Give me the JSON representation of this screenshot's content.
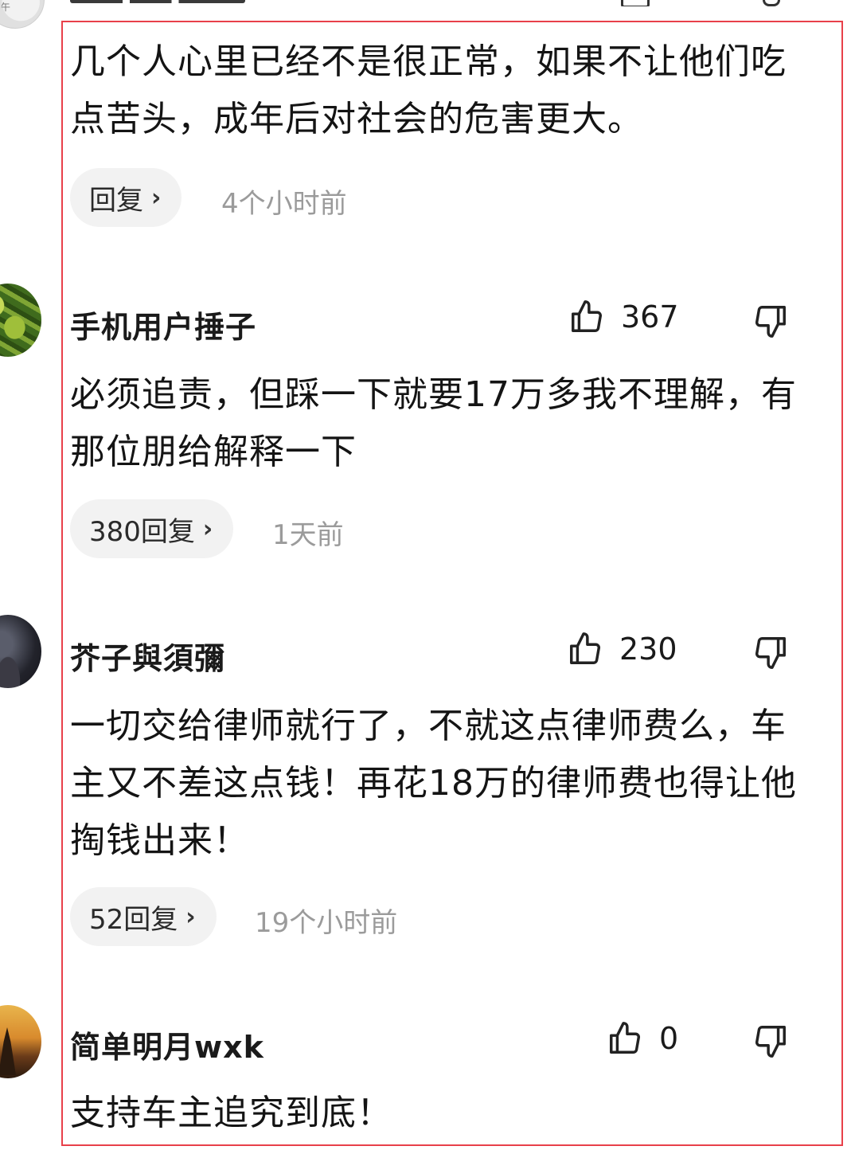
{
  "comments": [
    {
      "text": "几个人心里已经不是很正常，如果不让他们吃点苦头，成年后对社会的危害更大。",
      "reply_label": "回复",
      "time": "4个小时前"
    },
    {
      "username": "手机用户捶子",
      "likes": "367",
      "text": "必须追责，但踩一下就要17万多我不理解，有那位朋给解释一下",
      "reply_label": "380回复",
      "time": "1天前"
    },
    {
      "username": "芥子與須彌",
      "likes": "230",
      "text": "一切交给律师就行了，不就这点律师费么，车主又不差这点钱！再花18万的律师费也得让他掏钱出来！",
      "reply_label": "52回复",
      "time": "19个小时前"
    },
    {
      "username": "简单明月wxk",
      "likes": "0",
      "text": "支持车主追究到底！"
    }
  ],
  "icons": {
    "like": "thumbs-up-outline",
    "dislike": "thumbs-down-outline",
    "chevron": "chevron-right"
  },
  "colors": {
    "highlight_border": "#e8404a",
    "pill_bg": "#f2f2f2",
    "timestamp": "#9b9b9b"
  }
}
